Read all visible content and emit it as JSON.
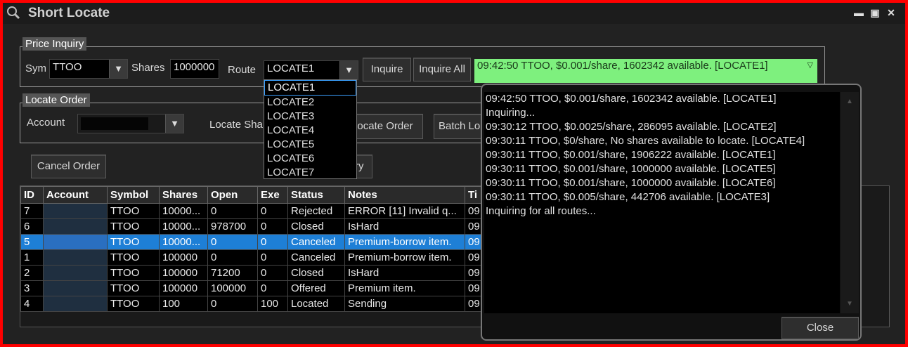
{
  "window": {
    "title": "Short Locate"
  },
  "price_inquiry": {
    "label": "Price Inquiry",
    "sym_label": "Sym",
    "sym_value": "TTOO",
    "shares_label": "Shares",
    "shares_value": "1000000",
    "route_label": "Route",
    "route_value": "LOCATE1",
    "inquire": "Inquire",
    "inquire_all": "Inquire All",
    "status": "09:42:50 TTOO, $0.001/share, 1602342 available. [LOCATE1]"
  },
  "route_options": [
    "LOCATE1",
    "LOCATE2",
    "LOCATE3",
    "LOCATE4",
    "LOCATE5",
    "LOCATE6",
    "LOCATE7"
  ],
  "locate_order": {
    "label": "Locate Order",
    "account_label": "Account",
    "locate_shares_label": "Locate Sha",
    "locate_order_btn": "ocate Order",
    "batch_btn": "Batch Lo"
  },
  "actions": {
    "cancel_order": "Cancel Order",
    "partial_btn": "ry"
  },
  "table": {
    "columns": [
      "ID",
      "Account",
      "Symbol",
      "Shares",
      "Open",
      "Exe",
      "Status",
      "Notes",
      "Ti"
    ],
    "rows": [
      [
        "7",
        "",
        "TTOO",
        "10000...",
        "0",
        "0",
        "Rejected",
        "ERROR [11] Invalid q...",
        "09"
      ],
      [
        "6",
        "",
        "TTOO",
        "10000...",
        "978700",
        "0",
        "Closed",
        "IsHard",
        "09"
      ],
      [
        "5",
        "",
        "TTOO",
        "10000...",
        "0",
        "0",
        "Canceled",
        "Premium-borrow item.",
        "09"
      ],
      [
        "1",
        "",
        "TTOO",
        "100000",
        "0",
        "0",
        "Canceled",
        "Premium-borrow item.",
        "09"
      ],
      [
        "2",
        "",
        "TTOO",
        "100000",
        "71200",
        "0",
        "Closed",
        "IsHard",
        "09"
      ],
      [
        "3",
        "",
        "TTOO",
        "100000",
        "100000",
        "0",
        "Offered",
        "Premium item.",
        "09"
      ],
      [
        "4",
        "",
        "TTOO",
        "100",
        "0",
        "100",
        "Located",
        "Sending",
        "09"
      ]
    ],
    "selected_row": 2
  },
  "log_popup": {
    "lines": [
      "09:42:50 TTOO, $0.001/share, 1602342 available. [LOCATE1]",
      "Inquiring...",
      "09:30:12 TTOO, $0.0025/share, 286095 available. [LOCATE2]",
      "09:30:11 TTOO, $0/share, No shares available to locate. [LOCATE4]",
      "09:30:11 TTOO, $0.001/share, 1906222 available. [LOCATE1]",
      "09:30:11 TTOO, $0.001/share, 1000000 available. [LOCATE5]",
      "09:30:11 TTOO, $0.001/share, 1000000 available. [LOCATE6]",
      "09:30:11 TTOO, $0.005/share, 442706 available. [LOCATE3]",
      "Inquiring for all routes..."
    ],
    "close": "Close"
  },
  "colors": {
    "frame": "#ff0000",
    "selected_row": "#1e7fd6",
    "status_green": "#7ef07e"
  }
}
